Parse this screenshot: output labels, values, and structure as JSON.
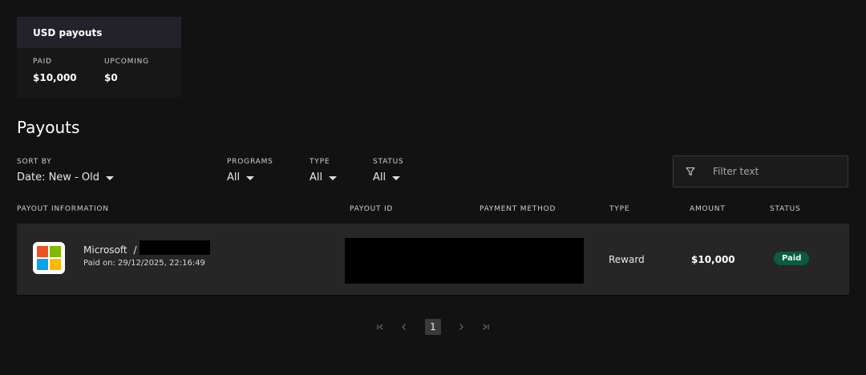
{
  "summary": {
    "title": "USD payouts",
    "paid_label": "PAID",
    "paid_value": "$10,000",
    "upcoming_label": "UPCOMING",
    "upcoming_value": "$0"
  },
  "page_title": "Payouts",
  "filters": {
    "sort_label": "SORT BY",
    "sort_value": "Date: New - Old",
    "programs_label": "PROGRAMS",
    "programs_value": "All",
    "type_label": "TYPE",
    "type_value": "All",
    "status_label": "STATUS",
    "status_value": "All",
    "search_placeholder": "Filter text"
  },
  "table": {
    "headers": [
      "PAYOUT INFORMATION",
      "PAYOUT ID",
      "PAYMENT METHOD",
      "TYPE",
      "AMOUNT",
      "STATUS"
    ],
    "rows": [
      {
        "program": "Microsoft",
        "separator": "/",
        "paid_on": "Paid on: 29/12/2025, 22:16:49",
        "type": "Reward",
        "amount": "$10,000",
        "status": "Paid"
      }
    ]
  },
  "pagination": {
    "first": "⏮",
    "prev": "‹",
    "current": "1",
    "next": "›",
    "last": "⏭"
  },
  "colors": {
    "ms_red": "#f25022",
    "ms_green": "#7fba00",
    "ms_blue": "#00a4ef",
    "ms_yellow": "#ffb900",
    "paid_badge": "#0c5b3e"
  }
}
